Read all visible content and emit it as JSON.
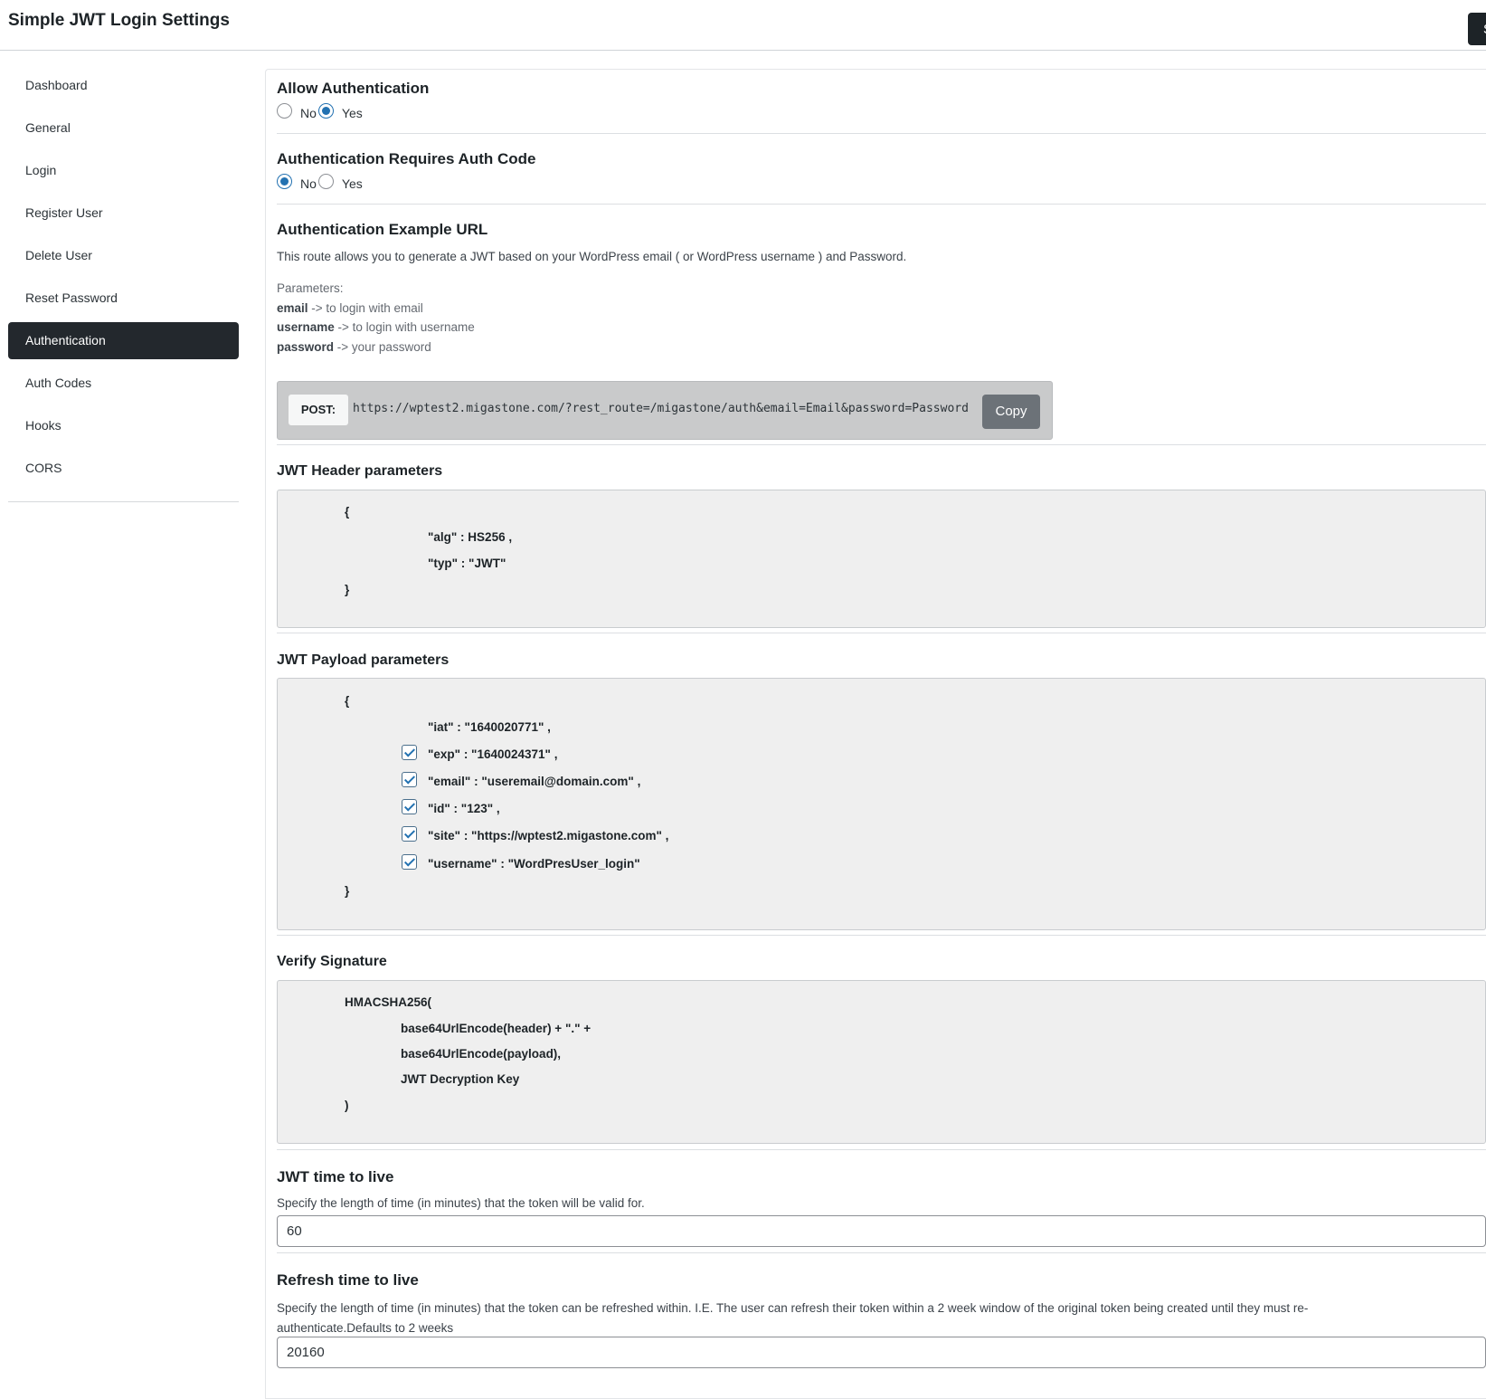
{
  "header": {
    "title": "Simple JWT Login Settings",
    "save_label": "S"
  },
  "sidebar": {
    "items": [
      {
        "label": "Dashboard"
      },
      {
        "label": "General"
      },
      {
        "label": "Login"
      },
      {
        "label": "Register User"
      },
      {
        "label": "Delete User"
      },
      {
        "label": "Reset Password"
      },
      {
        "label": "Authentication",
        "active": true
      },
      {
        "label": "Auth Codes"
      },
      {
        "label": "Hooks"
      },
      {
        "label": "CORS"
      }
    ]
  },
  "allow_auth": {
    "title": "Allow Authentication",
    "no_label": "No",
    "yes_label": "Yes",
    "selected": "Yes"
  },
  "requires_code": {
    "title": "Authentication Requires Auth Code",
    "no_label": "No",
    "yes_label": "Yes",
    "selected": "No"
  },
  "example_url": {
    "title": "Authentication Example URL",
    "description": "This route allows you to generate a JWT based on your WordPress email ( or WordPress username ) and Password.",
    "params_label": "Parameters:",
    "params": [
      {
        "name": "email",
        "text": " -> to login with email"
      },
      {
        "name": "username",
        "text": " -> to login with username"
      },
      {
        "name": "password",
        "text": " -> your password"
      }
    ],
    "method": "POST:",
    "url": "https://wptest2.migastone.com/?rest_route=/migastone/auth&email=Email&password=Password",
    "copy_label": "Copy"
  },
  "jwt_header": {
    "title": "JWT Header parameters",
    "open": "{",
    "lines": [
      "\"alg\" : HS256 ,",
      "\"typ\" : \"JWT\""
    ],
    "close": "}"
  },
  "jwt_payload": {
    "title": "JWT Payload parameters",
    "open": "{",
    "iat": "\"iat\" : \"1640020771\" ,",
    "lines": [
      {
        "text": "\"exp\" : \"1640024371\" ,",
        "checked": true
      },
      {
        "text": "\"email\" : \"useremail@domain.com\" ,",
        "checked": true
      },
      {
        "text": "\"id\" : \"123\" ,",
        "checked": true
      },
      {
        "text": "\"site\" : \"https://wptest2.migastone.com\" ,",
        "checked": true
      },
      {
        "text": "\"username\" : \"WordPresUser_login\"",
        "checked": true
      }
    ],
    "close": "}"
  },
  "verify": {
    "title": "Verify Signature",
    "lines": [
      "HMACSHA256(",
      "base64UrlEncode(header) + \".\" +",
      "base64UrlEncode(payload),",
      "JWT Decryption Key",
      ")"
    ]
  },
  "ttl": {
    "title": "JWT time to live",
    "description": "Specify the length of time (in minutes) that the token will be valid for.",
    "value": "60"
  },
  "refresh": {
    "title": "Refresh time to live",
    "description": "Specify the length of time (in minutes) that the token can be refreshed within. I.E. The user can refresh their token within a 2 week window of the original token being created until they must re-authenticate.Defaults to 2 weeks",
    "value": "20160"
  }
}
